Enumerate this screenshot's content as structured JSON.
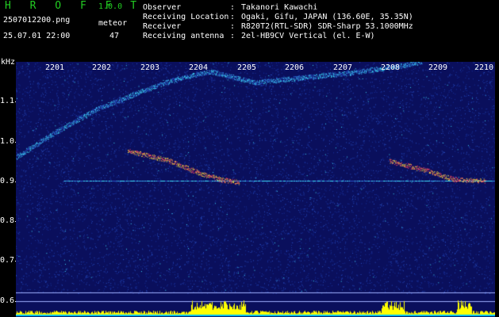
{
  "app": {
    "title": "H R O F F T",
    "version": "1.0.0"
  },
  "file": {
    "name": "2507012200.png",
    "datetime": "25.07.01 22:00"
  },
  "detection": {
    "mode": "meteor",
    "count": "47"
  },
  "info": [
    {
      "key": "Observer",
      "value": "Takanori Kawachi"
    },
    {
      "key": "Receiving Location",
      "value": "Ogaki, Gifu, JAPAN (136.60E, 35.35N)"
    },
    {
      "key": "Receiver",
      "value": "R820T2(RTL-SDR) SDR-Sharp 53.1000MHz"
    },
    {
      "key": "Receiving antenna",
      "value": "2el-HB9CV Vertical (el. E-W)"
    }
  ],
  "separator": ":",
  "axis": {
    "y_unit": "kHz",
    "y_ticks": [
      "1.1",
      "1.0",
      "0.9",
      "0.8",
      "0.7",
      "0.6"
    ],
    "x_ticks": [
      "2201",
      "2202",
      "2203",
      "2204",
      "2205",
      "2206",
      "2207",
      "2208",
      "2209",
      "2210"
    ]
  },
  "colors": {
    "background": "#000000",
    "title_green": "#22cc22",
    "plot_bg": "#0a0f5c",
    "noise": "#2a52c8",
    "signal_hot": "#ff4060",
    "signal_warm": "#ffe040",
    "signal_cool": "#40e0ff",
    "level_bar": "#ffff00"
  }
}
